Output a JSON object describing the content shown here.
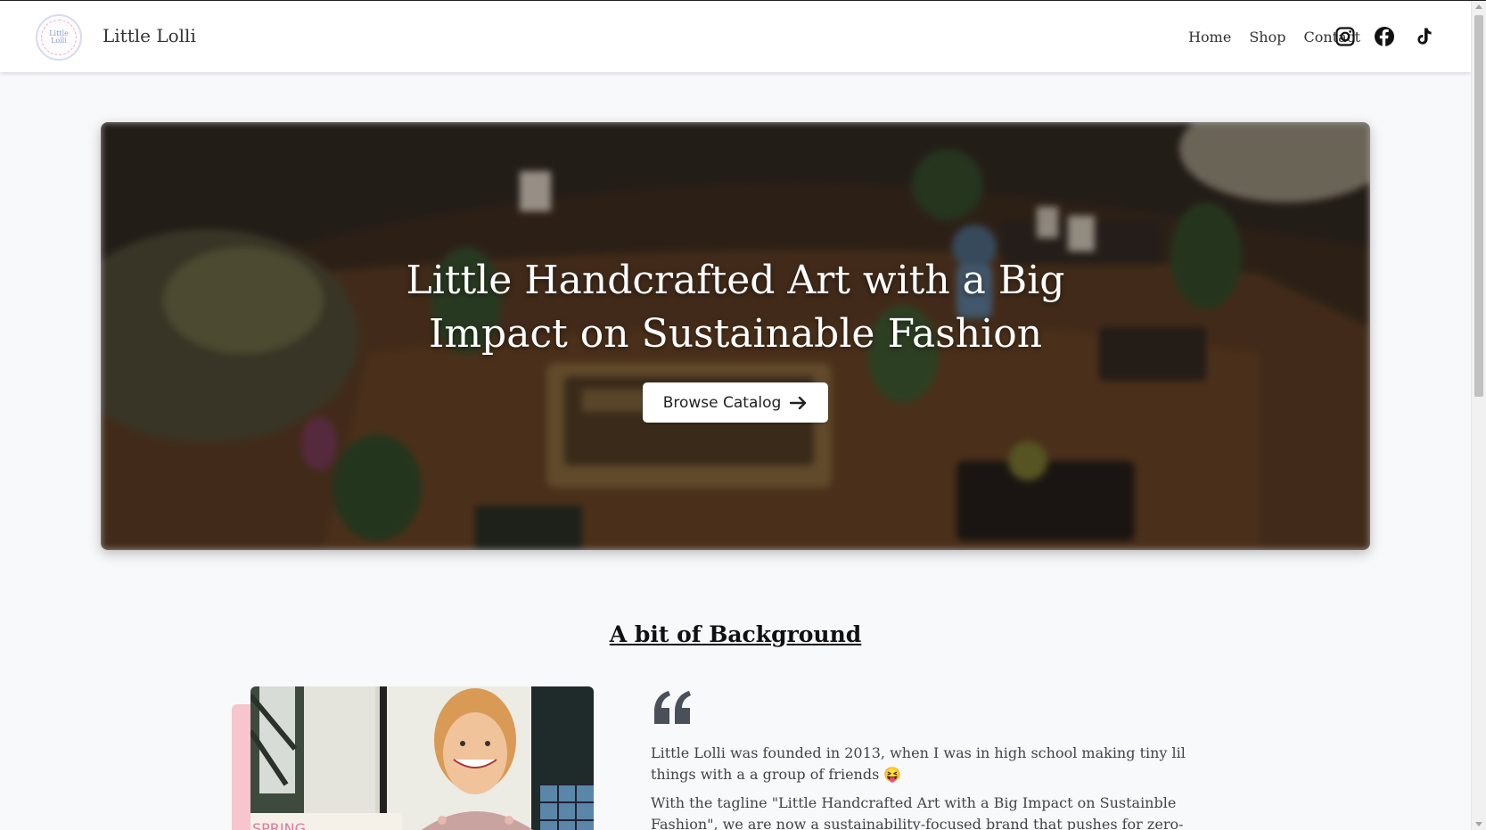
{
  "navbar": {
    "brand": "Little Lolli",
    "logo_text": "Little Lolli",
    "links": [
      {
        "label": "Home"
      },
      {
        "label": "Shop"
      },
      {
        "label": "Contact"
      }
    ],
    "social_icons": [
      "instagram-icon",
      "facebook-icon",
      "tiktok-icon"
    ]
  },
  "hero": {
    "title": "Little Handcrafted Art with a Big Impact on Sustainable Fashion",
    "button_label": "Browse Catalog",
    "button_icon": "arrow-right-icon"
  },
  "background": {
    "title": "A bit of Background",
    "quote_icon": "quote-icon",
    "paragraphs": [
      "Little Lolli was founded in 2013, when I was in high school making tiny lil things with a a group of friends 😝",
      "With the tagline \"Little Handcrafted Art with a Big Impact on Sustainble Fashion\", we are now a sustainability-focused brand that pushes for zero-waste, creations with intentions,"
    ],
    "photo_sign_text": "SPRING"
  },
  "colors": {
    "accent_pink": "#f7c5cd",
    "page_bg": "#f8f9fb",
    "text": "#222222"
  }
}
